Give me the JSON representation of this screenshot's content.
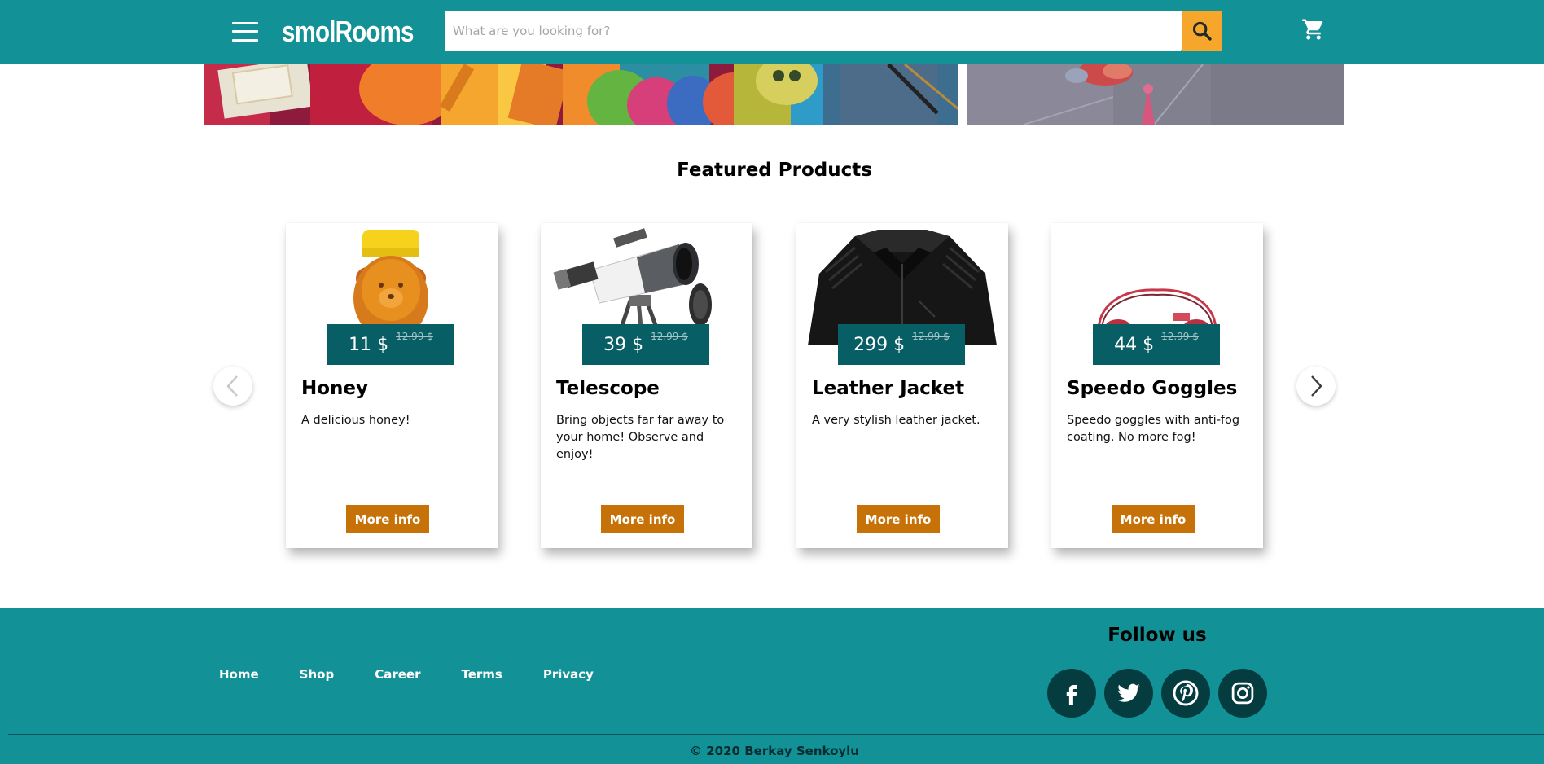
{
  "header": {
    "logo": "smolRooms",
    "search_placeholder": "What are you looking for?",
    "menu_icon": "hamburger-menu-icon",
    "search_icon": "search-icon",
    "cart_icon": "cart-icon",
    "bg_color": "#129196",
    "search_button_color": "#f6a62b"
  },
  "featured": {
    "title": "Featured Products",
    "products": [
      {
        "name": "Honey",
        "price": "11 $",
        "old_price": "12.99 $",
        "description": "A delicious honey!",
        "button": "More info",
        "image": "honey-bear-bottle"
      },
      {
        "name": "Telescope",
        "price": "39 $",
        "old_price": "12.99 $",
        "description": "Bring objects far far away to your home! Observe and enjoy!",
        "button": "More info",
        "image": "telescope"
      },
      {
        "name": "Leather Jacket",
        "price": "299 $",
        "old_price": "12.99 $",
        "description": "A very stylish leather jacket.",
        "button": "More info",
        "image": "leather-jacket"
      },
      {
        "name": "Speedo Goggles",
        "price": "44 $",
        "old_price": "12.99 $",
        "description": "Speedo goggles with anti-fog coating. No more fog!",
        "button": "More info",
        "image": "swim-goggles"
      }
    ],
    "prev_icon": "chevron-left-icon",
    "next_icon": "chevron-right-icon",
    "price_bg_color": "#075f65",
    "button_color": "#c67208"
  },
  "footer": {
    "nav": [
      "Home",
      "Shop",
      "Career",
      "Terms",
      "Privacy"
    ],
    "follow_title": "Follow us",
    "social_icons": [
      "facebook-icon",
      "twitter-icon",
      "pinterest-icon",
      "instagram-icon"
    ],
    "copyright": "© 2020 Berkay Senkoylu",
    "bg_color": "#129196"
  }
}
